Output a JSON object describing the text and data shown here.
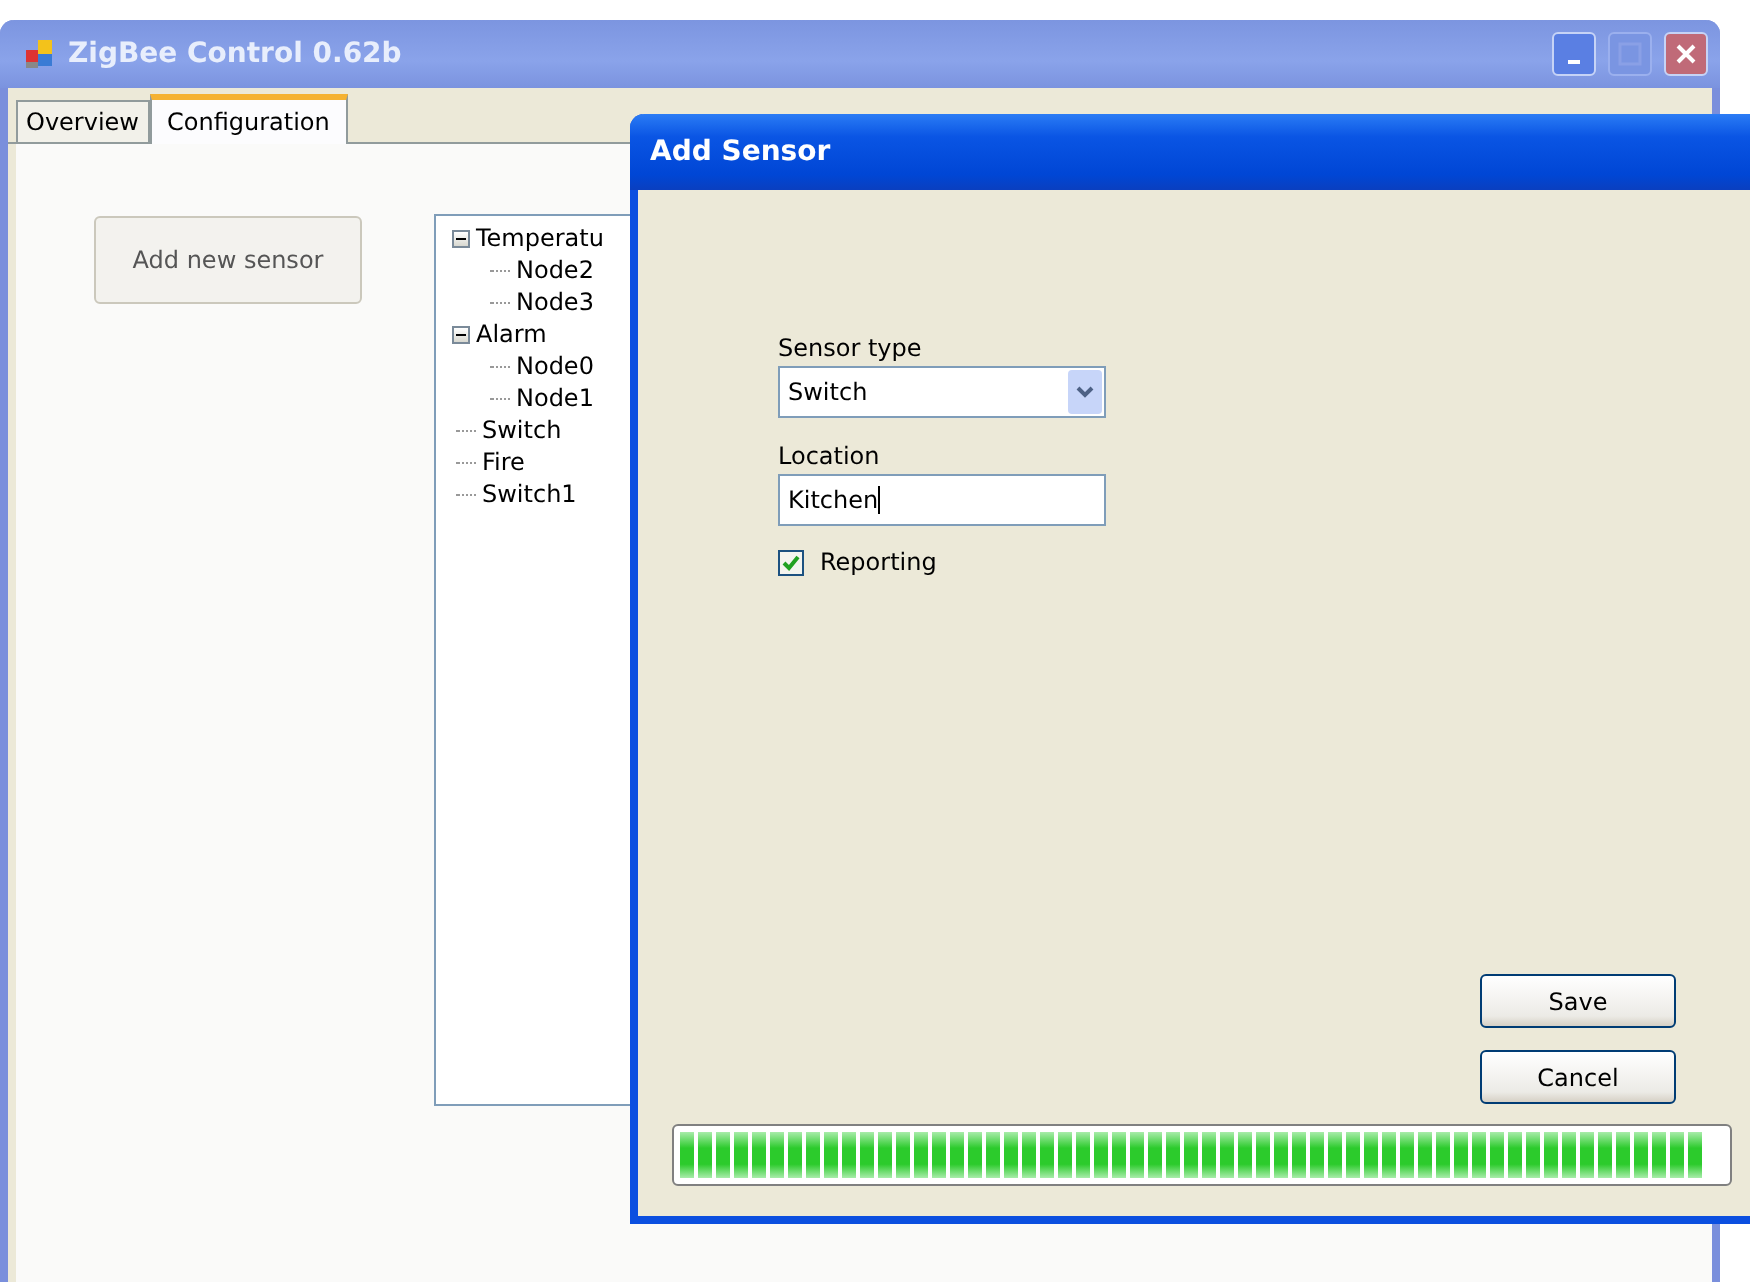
{
  "window": {
    "title": "ZigBee Control 0.62b"
  },
  "tabs": [
    {
      "label": "Overview",
      "selected": false
    },
    {
      "label": "Configuration",
      "selected": true
    }
  ],
  "add_button": "Add new sensor",
  "tree": [
    {
      "label": "Temperatu",
      "expanded": true,
      "children": [
        {
          "label": "Node2"
        },
        {
          "label": "Node3"
        }
      ]
    },
    {
      "label": "Alarm",
      "expanded": true,
      "children": [
        {
          "label": "Node0"
        },
        {
          "label": "Node1"
        }
      ]
    },
    {
      "label": "Switch"
    },
    {
      "label": "Fire"
    },
    {
      "label": "Switch1"
    }
  ],
  "dialog": {
    "title": "Add Sensor",
    "sensor_type_label": "Sensor type",
    "sensor_type": "Switch",
    "location_label": "Location",
    "location": "Kitchen",
    "reporting": {
      "label": "Reporting",
      "checked": true
    },
    "buttons": [
      "Save",
      "Cancel"
    ],
    "progress": {
      "level": 1
    }
  }
}
